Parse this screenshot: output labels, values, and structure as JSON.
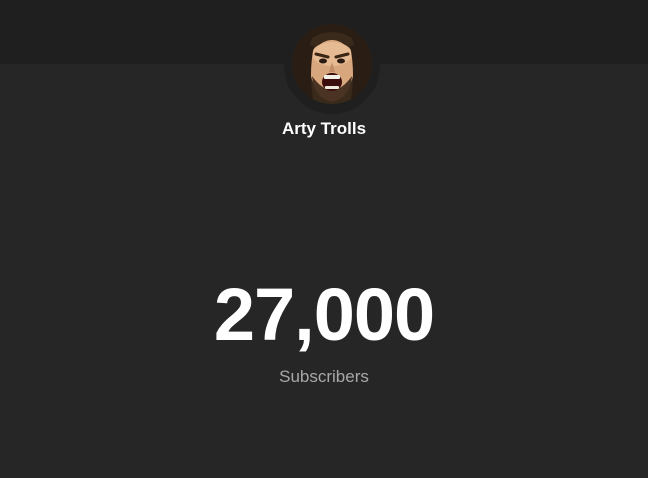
{
  "channel": {
    "name": "Arty Trolls",
    "avatar_icon": "avatar-photo"
  },
  "stats": {
    "subscriber_count": "27,000",
    "subscriber_label": "Subscribers"
  },
  "colors": {
    "background": "#262626",
    "header_band": "#1f1f1f",
    "primary_text": "#ffffff",
    "secondary_text": "#a8a8a8"
  }
}
